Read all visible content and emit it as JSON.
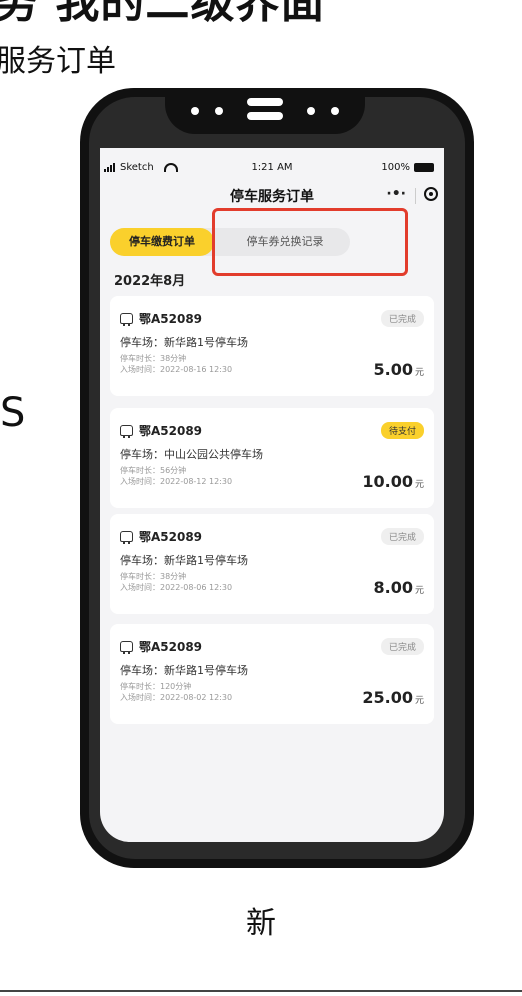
{
  "slide": {
    "title": "务  我的二级界面",
    "subtitle": "服务订单",
    "side_letter": "S",
    "bottom_char": "新"
  },
  "statusbar": {
    "carrier": "Sketch",
    "time": "1:21 AM",
    "battery": "100%"
  },
  "navbar": {
    "title": "停车服务订单",
    "more_icon": "more-icon",
    "target_icon": "target-icon"
  },
  "tabs": [
    {
      "label": "停车缴费订单",
      "active": true
    },
    {
      "label": "停车券兑换记录",
      "active": false
    }
  ],
  "month": "2022年8月",
  "orders": [
    {
      "plate": "鄂A52089",
      "status": "已完成",
      "lot": "停车场：新华路1号停车场",
      "duration": "停车时长：38分钟",
      "entry": "入场时间：2022-08-16 12:30",
      "amount": "5.00",
      "unit": "元"
    },
    {
      "plate": "鄂A52089",
      "status": "待支付",
      "lot": "停车场：中山公园公共停车场",
      "duration": "停车时长：56分钟",
      "entry": "入场时间：2022-08-12 12:30",
      "amount": "10.00",
      "unit": "元"
    },
    {
      "plate": "鄂A52089",
      "status": "已完成",
      "lot": "停车场：新华路1号停车场",
      "duration": "停车时长：38分钟",
      "entry": "入场时间：2022-08-06 12:30",
      "amount": "8.00",
      "unit": "元"
    },
    {
      "plate": "鄂A52089",
      "status": "已完成",
      "lot": "停车场：新华路1号停车场",
      "duration": "停车时长：120分钟",
      "entry": "入场时间：2022-08-02 12:30",
      "amount": "25.00",
      "unit": "元"
    }
  ],
  "colors": {
    "accent": "#fad02c",
    "highlight_border": "#e23c2c",
    "screen_bg": "#f4f4f6"
  }
}
